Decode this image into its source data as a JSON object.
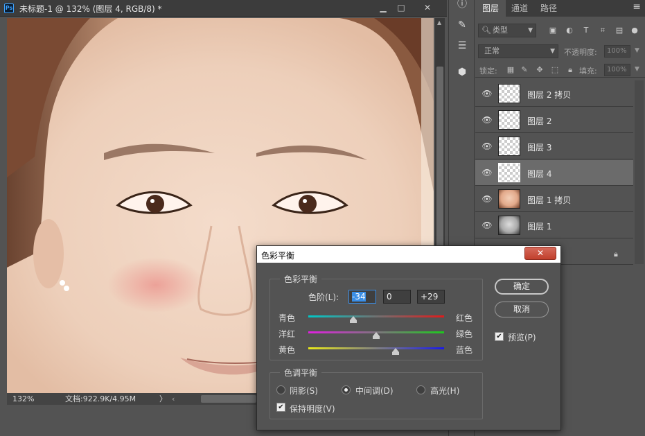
{
  "document": {
    "title": "未标题-1 @ 132% (图层 4, RGB/8) *",
    "app_badge": "Ps",
    "window_buttons": [
      "▁",
      "□",
      "✕"
    ],
    "status_zoom": "132%",
    "status_doc": "文档:922.9K/4.95M",
    "status_arrow": "〉",
    "hscroll_left": "‹"
  },
  "tool_icons": [
    "info-icon",
    "brush-icon",
    "adjust-sliders-icon",
    "cube-icon"
  ],
  "layers_panel": {
    "tabs": [
      "图层",
      "通道",
      "路径"
    ],
    "active_tab": "图层",
    "kind_filter": "类型",
    "blend_mode": "正常",
    "opacity_label": "不透明度:",
    "opacity_value": "100%",
    "lock_label": "锁定:",
    "fill_label": "填充:",
    "fill_value": "100%",
    "layers": [
      {
        "name": "图层 2 拷贝",
        "thumb": "transparent",
        "selected": false
      },
      {
        "name": "图层 2",
        "thumb": "transparent",
        "selected": false
      },
      {
        "name": "图层 3",
        "thumb": "transparent",
        "selected": false
      },
      {
        "name": "图层 4",
        "thumb": "transparent",
        "selected": true
      },
      {
        "name": "图层 1 拷贝",
        "thumb": "face",
        "selected": false
      },
      {
        "name": "图层 1",
        "thumb": "gray",
        "selected": false
      }
    ]
  },
  "dialog": {
    "title": "色彩平衡",
    "close": "✕",
    "color_balance_group": "色彩平衡",
    "levels_label": "色阶(L):",
    "levels": [
      "-34",
      "0",
      "+29"
    ],
    "sliders": [
      {
        "left": "青色",
        "right": "红色",
        "value": -34,
        "gradient": [
          "#00c8c8",
          "#e01b1b"
        ]
      },
      {
        "left": "洋红",
        "right": "绿色",
        "value": 0,
        "gradient": [
          "#e020e0",
          "#1ec81e"
        ]
      },
      {
        "left": "黄色",
        "right": "蓝色",
        "value": 29,
        "gradient": [
          "#e8e81a",
          "#1a1ae8"
        ]
      }
    ],
    "tone_group": "色调平衡",
    "tones": [
      {
        "label": "阴影(S)",
        "checked": false
      },
      {
        "label": "中间调(D)",
        "checked": true
      },
      {
        "label": "高光(H)",
        "checked": false
      }
    ],
    "preserve_luminosity": "保持明度(V)",
    "preserve_checked": true,
    "ok_label": "确定",
    "cancel_label": "取消",
    "preview_label": "预览(P)",
    "preview_checked": true
  }
}
